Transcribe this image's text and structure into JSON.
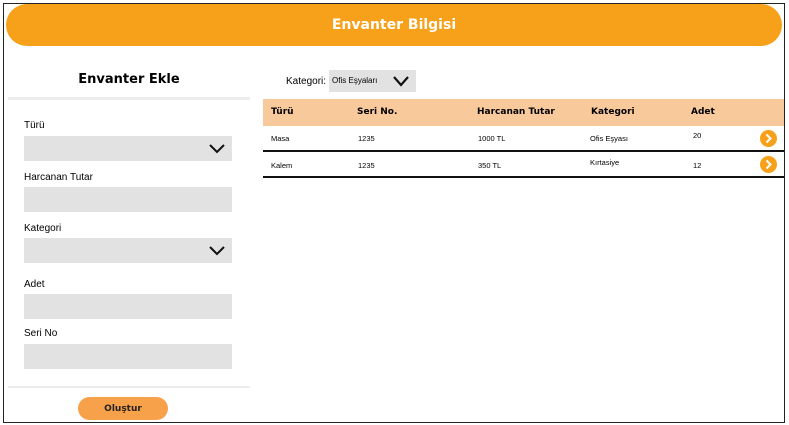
{
  "header": {
    "title": "Envanter Bilgisi"
  },
  "add_panel": {
    "title": "Envanter Ekle",
    "fields": {
      "type": {
        "label": "Türü",
        "value": ""
      },
      "amount": {
        "label": "Harcanan Tutar",
        "value": ""
      },
      "category": {
        "label": "Kategori",
        "value": ""
      },
      "quantity": {
        "label": "Adet",
        "value": ""
      },
      "serial": {
        "label": "Seri No",
        "value": ""
      }
    },
    "create_label": "Oluştur"
  },
  "filter": {
    "label": "Kategori:",
    "value": "Ofis Eşyaları"
  },
  "table": {
    "columns": [
      "Türü",
      "Seri No.",
      "Harcanan Tutar",
      "Kategori",
      "Adet"
    ],
    "rows": [
      [
        "Masa",
        "1235",
        "1000 TL",
        "Ofis Eşyası",
        "20"
      ],
      [
        "Kalem",
        "1235",
        "350 TL",
        "Kırtasiye",
        "12"
      ]
    ]
  },
  "icons": {
    "dropdown": "chevron-down-icon",
    "row_action": "chevron-right-icon"
  },
  "colors": {
    "accent": "#f7a11a",
    "table_header": "#f8c99a",
    "field_bg": "#e2e2e2"
  }
}
